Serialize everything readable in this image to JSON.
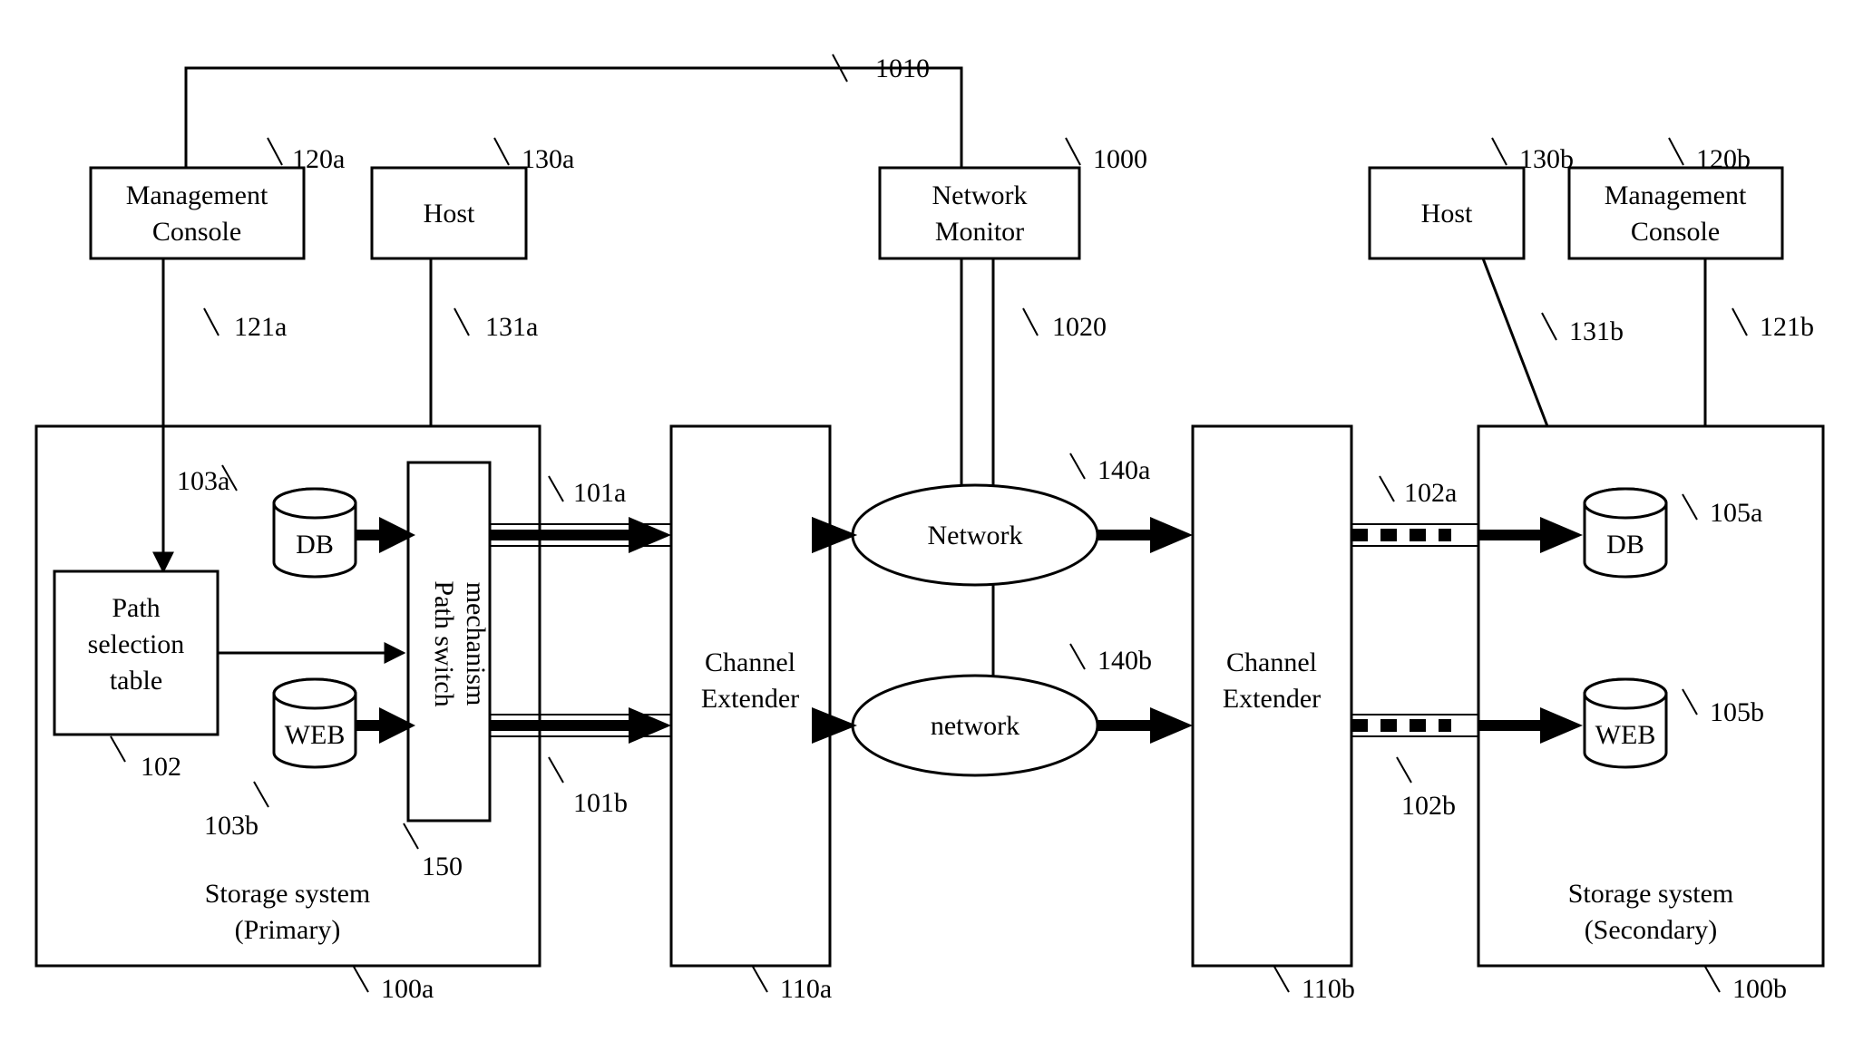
{
  "mgmtA": {
    "title1": "Management",
    "title2": "Console",
    "ref": "120a",
    "link": "121a"
  },
  "hostA": {
    "title": "Host",
    "ref": "130a",
    "link": "131a"
  },
  "monitor": {
    "title1": "Network",
    "title2": "Monitor",
    "ref": "1000",
    "linkTop": "1010",
    "linkBottom": "1020"
  },
  "hostB": {
    "title": "Host",
    "ref": "130b",
    "link": "131b"
  },
  "mgmtB": {
    "title1": "Management",
    "title2": "Console",
    "ref": "120b",
    "link": "121b"
  },
  "storageA": {
    "title1": "Storage system",
    "title2": "(Primary)",
    "ref": "100a"
  },
  "storageB": {
    "title1": "Storage system",
    "title2": "(Secondary)",
    "ref": "100b"
  },
  "pst": {
    "label1": "Path",
    "label2": "selection",
    "label3": "table",
    "ref": "102"
  },
  "psm": {
    "label1": "Path switch",
    "label2": "mechanism",
    "ref": "150"
  },
  "dbA": {
    "label": "DB",
    "ref": "103a"
  },
  "webA": {
    "label": "WEB",
    "ref": "103b"
  },
  "dbB": {
    "label": "DB",
    "ref": "105a"
  },
  "webB": {
    "label": "WEB",
    "ref": "105b"
  },
  "extA": {
    "label1": "Channel",
    "label2": "Extender",
    "ref": "110a"
  },
  "extB": {
    "label1": "Channel",
    "label2": "Extender",
    "ref": "110b"
  },
  "netA": {
    "label": "Network",
    "ref": "140a"
  },
  "netB": {
    "label": "network",
    "ref": "140b"
  },
  "portsA": {
    "top": "101a",
    "bottom": "101b"
  },
  "portsB": {
    "top": "102a",
    "bottom": "102b"
  }
}
